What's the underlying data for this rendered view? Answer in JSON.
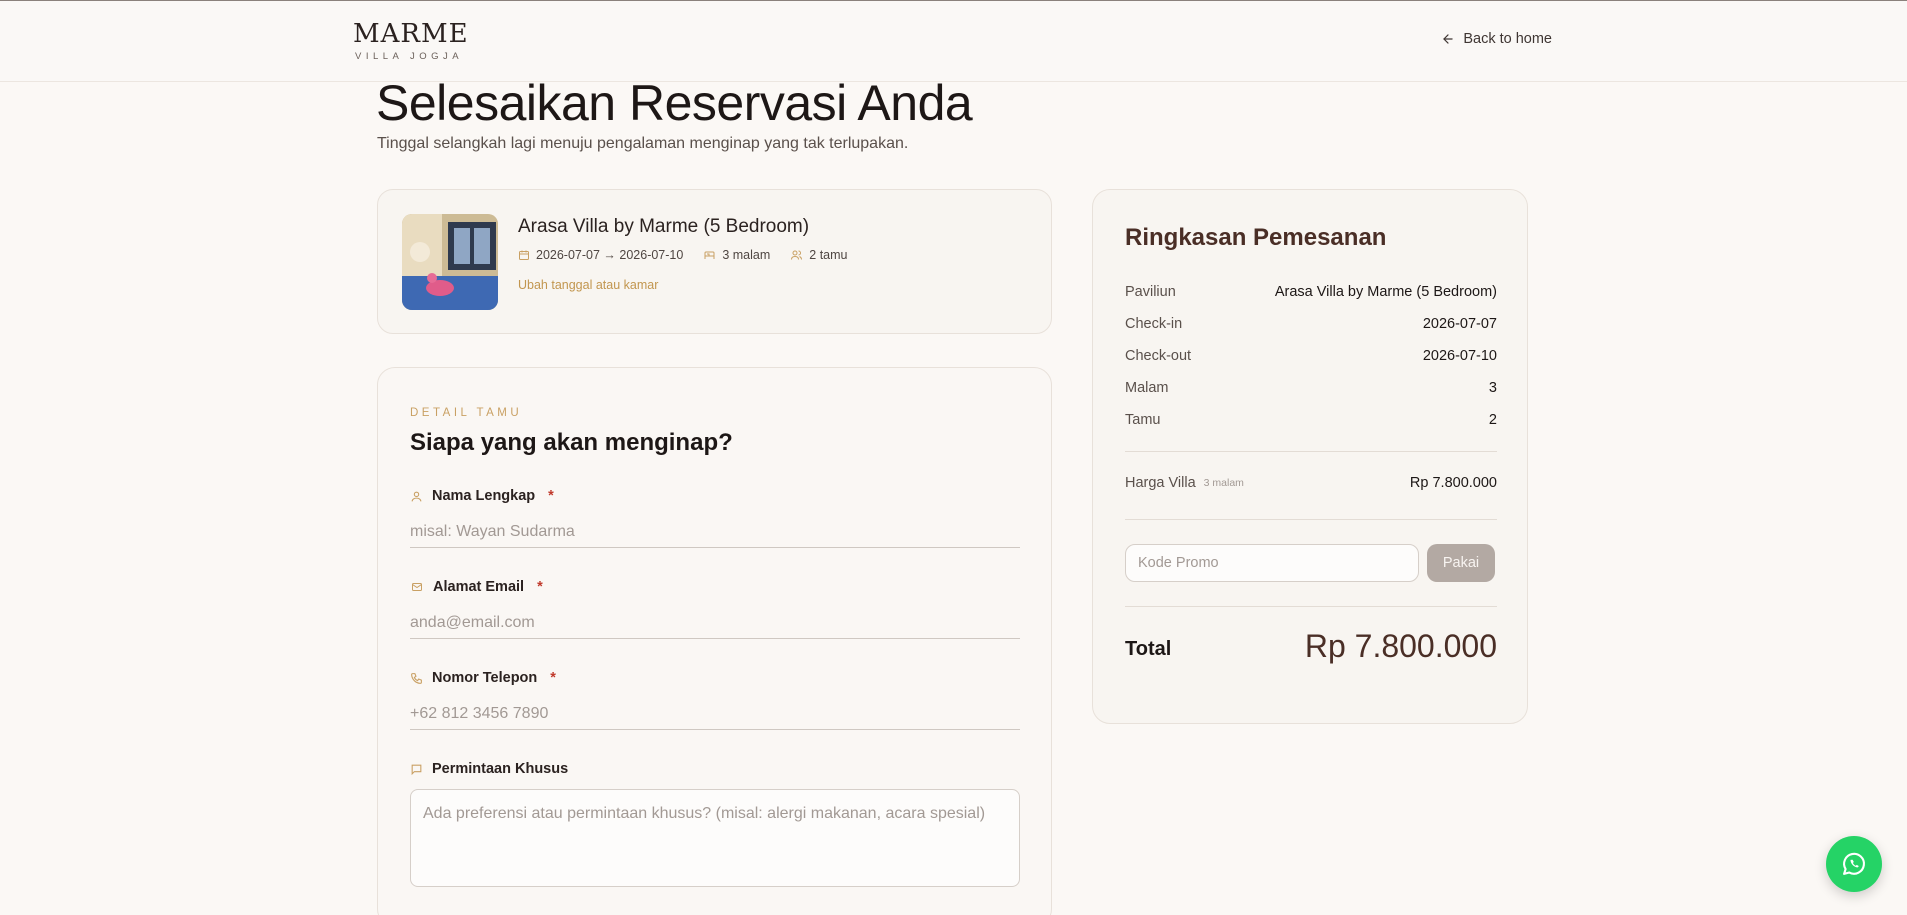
{
  "header": {
    "logo_main": "MARME",
    "logo_sub": "VILLA JOGJA",
    "back_label": "Back to home"
  },
  "page": {
    "title": "Selesaikan Reservasi Anda",
    "subtitle": "Tinggal selangkah lagi menuju pengalaman menginap yang tak terlupakan."
  },
  "villa": {
    "name": "Arasa Villa by Marme (5 Bedroom)",
    "dates": "2026-07-07 → 2026-07-10",
    "nights": "3 malam",
    "guests": "2 tamu",
    "change_link": "Ubah tanggal atau kamar"
  },
  "form": {
    "section_label": "DETAIL TAMU",
    "section_title": "Siapa yang akan menginap?",
    "required_mark": "*",
    "name": {
      "label": "Nama Lengkap",
      "placeholder": "misal: Wayan Sudarma"
    },
    "email": {
      "label": "Alamat Email",
      "placeholder": "anda@email.com"
    },
    "phone": {
      "label": "Nomor Telepon",
      "placeholder": "+62 812 3456 7890"
    },
    "special": {
      "label": "Permintaan Khusus",
      "placeholder": "Ada preferensi atau permintaan khusus? (misal: alergi makanan, acara spesial)"
    }
  },
  "summary": {
    "title": "Ringkasan Pemesanan",
    "rows": [
      {
        "key": "Paviliun",
        "value": "Arasa Villa by Marme (5 Bedroom)"
      },
      {
        "key": "Check-in",
        "value": "2026-07-07"
      },
      {
        "key": "Check-out",
        "value": "2026-07-10"
      },
      {
        "key": "Malam",
        "value": "3"
      },
      {
        "key": "Tamu",
        "value": "2"
      }
    ],
    "price_label": "Harga Villa",
    "price_note": "3 malam",
    "price_value": "Rp 7.800.000",
    "promo_placeholder": "Kode Promo",
    "promo_button": "Pakai",
    "total_label": "Total",
    "total_value": "Rp 7.800.000"
  },
  "colors": {
    "accent_gold": "#c9a063",
    "brand_brown": "#4a2e26",
    "whatsapp_green": "#25d366"
  },
  "icons": {
    "back": "arrow-left-icon",
    "calendar": "calendar-icon",
    "bed": "bed-icon",
    "guests": "users-icon",
    "user": "user-icon",
    "mail": "mail-icon",
    "phone": "phone-icon",
    "message": "message-icon",
    "whatsapp": "whatsapp-icon"
  }
}
